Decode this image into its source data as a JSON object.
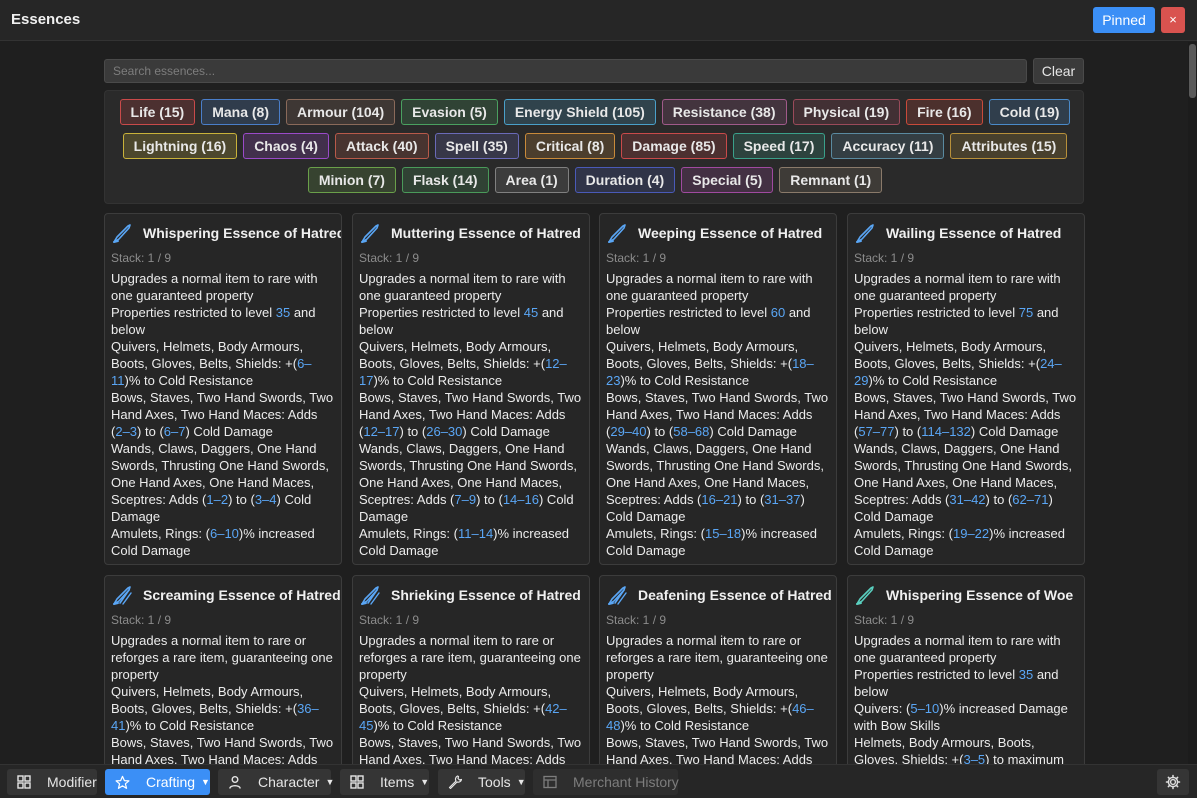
{
  "window": {
    "title": "Essences",
    "pinned_label": "Pinned",
    "close_label": "×"
  },
  "search": {
    "placeholder": "Search essences...",
    "value": "",
    "clear_label": "Clear"
  },
  "tags": [
    [
      {
        "label": "Life (15)",
        "color": "#c94a4a"
      },
      {
        "label": "Mana (8)",
        "color": "#4a7ec9"
      },
      {
        "label": "Armour (104)",
        "color": "#8a6a5a"
      },
      {
        "label": "Evasion (5)",
        "color": "#4aa060"
      },
      {
        "label": "Energy Shield (105)",
        "color": "#4aa0c9"
      },
      {
        "label": "Resistance (38)",
        "color": "#a05a8a"
      },
      {
        "label": "Physical (19)",
        "color": "#9a4a5a"
      },
      {
        "label": "Fire (16)",
        "color": "#c94a3a"
      },
      {
        "label": "Cold (19)",
        "color": "#4a8ac9"
      }
    ],
    [
      {
        "label": "Lightning (16)",
        "color": "#c9b23a"
      },
      {
        "label": "Chaos (4)",
        "color": "#9a4ac9"
      },
      {
        "label": "Attack (40)",
        "color": "#b85a4a"
      },
      {
        "label": "Spell (35)",
        "color": "#6a6ab8"
      },
      {
        "label": "Critical (8)",
        "color": "#c98a3a"
      },
      {
        "label": "Damage (85)",
        "color": "#c94a4a"
      },
      {
        "label": "Speed (17)",
        "color": "#3aa08a"
      },
      {
        "label": "Accuracy (11)",
        "color": "#5a8aa0"
      },
      {
        "label": "Attributes (15)",
        "color": "#b8903a"
      }
    ],
    [
      {
        "label": "Minion (7)",
        "color": "#6aa04a"
      },
      {
        "label": "Flask (14)",
        "color": "#4a9a5a"
      },
      {
        "label": "Area (1)",
        "color": "#808080"
      },
      {
        "label": "Duration (4)",
        "color": "#4a5ab8"
      },
      {
        "label": "Special (5)",
        "color": "#a04aa0"
      },
      {
        "label": "Remnant (1)",
        "color": "#8a7a6a"
      }
    ]
  ],
  "cards": [
    {
      "title": "Whispering Essence of Hatred",
      "stack": "Stack: 1 / 9",
      "icon": "hatred-essence-icon",
      "tint": "#5aa6f5",
      "lines": [
        [
          "Upgrades a normal item to rare with one guaranteed property"
        ],
        [
          "Properties restricted to level ",
          {
            "n": "35"
          },
          " and below"
        ],
        [
          "Quivers, Helmets, Body Armours, Boots, Gloves, Belts, Shields: +(",
          {
            "n": "6–11"
          },
          ")% to Cold Resistance"
        ],
        [
          "Bows, Staves, Two Hand Swords, Two Hand Axes, Two Hand Maces: Adds (",
          {
            "n": "2–3"
          },
          ") to (",
          {
            "n": "6–7"
          },
          ") Cold Damage"
        ],
        [
          "Wands, Claws, Daggers, One Hand Swords, Thrusting One Hand Swords, One Hand Axes, One Hand Maces, Sceptres: Adds (",
          {
            "n": "1–2"
          },
          ") to (",
          {
            "n": "3–4"
          },
          ") Cold Damage"
        ],
        [
          "Amulets, Rings: (",
          {
            "n": "6–10"
          },
          ")% increased Cold Damage"
        ]
      ]
    },
    {
      "title": "Muttering Essence of Hatred",
      "stack": "Stack: 1 / 9",
      "icon": "hatred-essence-icon",
      "tint": "#5aa6f5",
      "lines": [
        [
          "Upgrades a normal item to rare with one guaranteed property"
        ],
        [
          "Properties restricted to level ",
          {
            "n": "45"
          },
          " and below"
        ],
        [
          "Quivers, Helmets, Body Armours, Boots, Gloves, Belts, Shields: +(",
          {
            "n": "12–17"
          },
          ")% to Cold Resistance"
        ],
        [
          "Bows, Staves, Two Hand Swords, Two Hand Axes, Two Hand Maces: Adds (",
          {
            "n": "12–17"
          },
          ") to (",
          {
            "n": "26–30"
          },
          ") Cold Damage"
        ],
        [
          "Wands, Claws, Daggers, One Hand Swords, Thrusting One Hand Swords, One Hand Axes, One Hand Maces, Sceptres: Adds (",
          {
            "n": "7–9"
          },
          ") to (",
          {
            "n": "14–16"
          },
          ") Cold Damage"
        ],
        [
          "Amulets, Rings: (",
          {
            "n": "11–14"
          },
          ")% increased Cold Damage"
        ]
      ]
    },
    {
      "title": "Weeping Essence of Hatred",
      "stack": "Stack: 1 / 9",
      "icon": "hatred-essence-icon",
      "tint": "#5aa6f5",
      "lines": [
        [
          "Upgrades a normal item to rare with one guaranteed property"
        ],
        [
          "Properties restricted to level ",
          {
            "n": "60"
          },
          " and below"
        ],
        [
          "Quivers, Helmets, Body Armours, Boots, Gloves, Belts, Shields: +(",
          {
            "n": "18–23"
          },
          ")% to Cold Resistance"
        ],
        [
          "Bows, Staves, Two Hand Swords, Two Hand Axes, Two Hand Maces: Adds (",
          {
            "n": "29–40"
          },
          ") to (",
          {
            "n": "58–68"
          },
          ") Cold Damage"
        ],
        [
          "Wands, Claws, Daggers, One Hand Swords, Thrusting One Hand Swords, One Hand Axes, One Hand Maces, Sceptres: Adds (",
          {
            "n": "16–21"
          },
          ") to (",
          {
            "n": "31–37"
          },
          ") Cold Damage"
        ],
        [
          "Amulets, Rings: (",
          {
            "n": "15–18"
          },
          ")% increased Cold Damage"
        ]
      ]
    },
    {
      "title": "Wailing Essence of Hatred",
      "stack": "Stack: 1 / 9",
      "icon": "hatred-essence-icon",
      "tint": "#5aa6f5",
      "lines": [
        [
          "Upgrades a normal item to rare with one guaranteed property"
        ],
        [
          "Properties restricted to level ",
          {
            "n": "75"
          },
          " and below"
        ],
        [
          "Quivers, Helmets, Body Armours, Boots, Gloves, Belts, Shields: +(",
          {
            "n": "24–29"
          },
          ")% to Cold Resistance"
        ],
        [
          "Bows, Staves, Two Hand Swords, Two Hand Axes, Two Hand Maces: Adds (",
          {
            "n": "57–77"
          },
          ") to (",
          {
            "n": "114–132"
          },
          ") Cold Damage"
        ],
        [
          "Wands, Claws, Daggers, One Hand Swords, Thrusting One Hand Swords, One Hand Axes, One Hand Maces, Sceptres: Adds (",
          {
            "n": "31–42"
          },
          ") to (",
          {
            "n": "62–71"
          },
          ") Cold Damage"
        ],
        [
          "Amulets, Rings: (",
          {
            "n": "19–22"
          },
          ")% increased Cold Damage"
        ]
      ]
    },
    {
      "title": "Screaming Essence of Hatred",
      "stack": "Stack: 1 / 9",
      "icon": "hatred-essence-icon",
      "tint": "#5aa6f5",
      "lines": [
        [
          "Upgrades a normal item to rare or reforges a rare item, guaranteeing one property"
        ],
        [
          "Quivers, Helmets, Body Armours, Boots, Gloves, Belts, Shields: +(",
          {
            "n": "36–41"
          },
          ")% to Cold Resistance"
        ],
        [
          "Bows, Staves, Two Hand Swords, Two Hand Axes, Two Hand Maces: Adds"
        ]
      ]
    },
    {
      "title": "Shrieking Essence of Hatred",
      "stack": "Stack: 1 / 9",
      "icon": "hatred-essence-icon",
      "tint": "#5aa6f5",
      "lines": [
        [
          "Upgrades a normal item to rare or reforges a rare item, guaranteeing one property"
        ],
        [
          "Quivers, Helmets, Body Armours, Boots, Gloves, Belts, Shields: +(",
          {
            "n": "42–45"
          },
          ")% to Cold Resistance"
        ],
        [
          "Bows, Staves, Two Hand Swords, Two Hand Axes, Two Hand Maces: Adds"
        ]
      ]
    },
    {
      "title": "Deafening Essence of Hatred",
      "stack": "Stack: 1 / 9",
      "icon": "hatred-essence-icon",
      "tint": "#5aa6f5",
      "lines": [
        [
          "Upgrades a normal item to rare or reforges a rare item, guaranteeing one property"
        ],
        [
          "Quivers, Helmets, Body Armours, Boots, Gloves, Belts, Shields: +(",
          {
            "n": "46–48"
          },
          ")% to Cold Resistance"
        ],
        [
          "Bows, Staves, Two Hand Swords, Two Hand Axes, Two Hand Maces: Adds"
        ]
      ]
    },
    {
      "title": "Whispering Essence of Woe",
      "stack": "Stack: 1 / 9",
      "icon": "woe-essence-icon",
      "tint": "#5ad0c0",
      "lines": [
        [
          "Upgrades a normal item to rare with one guaranteed property"
        ],
        [
          "Properties restricted to level ",
          {
            "n": "35"
          },
          " and below"
        ],
        [
          "Quivers: (",
          {
            "n": "5–10"
          },
          ")% increased Damage with Bow Skills"
        ],
        [
          "Helmets, Body Armours, Boots, Gloves, Shields: +(",
          {
            "n": "3–5"
          },
          ") to maximum Energy Shield"
        ]
      ]
    }
  ],
  "bottom_nav": [
    {
      "label": "Modifier",
      "icon": "grid-icon",
      "caret": "",
      "state": "normal"
    },
    {
      "label": "Crafting",
      "icon": "star-icon",
      "caret": "▼",
      "state": "active"
    },
    {
      "label": "Character",
      "icon": "person-icon",
      "caret": "▼",
      "state": "normal"
    },
    {
      "label": "Items",
      "icon": "grid-icon",
      "caret": "▼",
      "state": "normal"
    },
    {
      "label": "Tools",
      "icon": "wrench-icon",
      "caret": "▼",
      "state": "normal"
    },
    {
      "label": "Merchant History",
      "icon": "table-icon",
      "caret": "",
      "state": "disabled"
    }
  ],
  "settings_icon": "gear-icon"
}
